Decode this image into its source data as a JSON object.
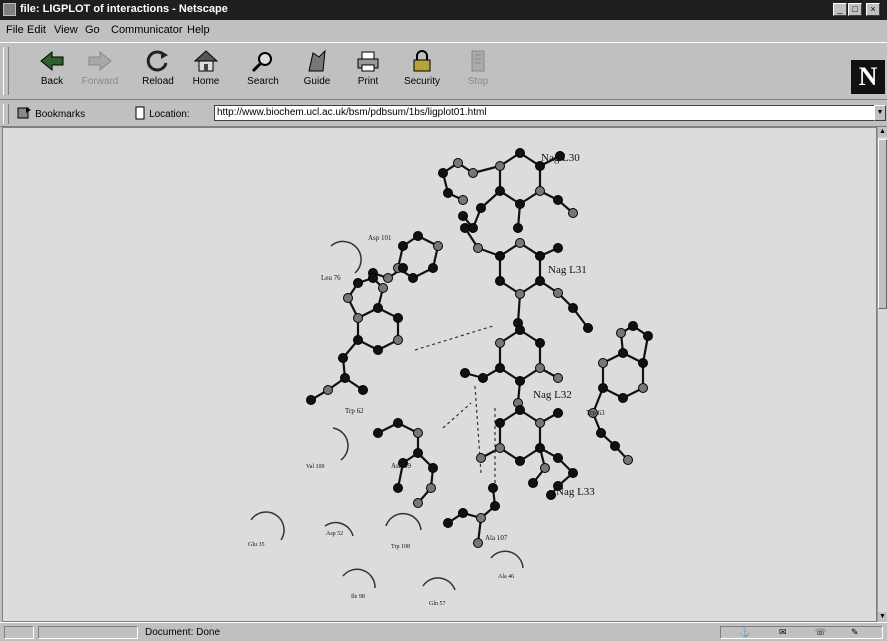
{
  "window": {
    "title": "file: LIGPLOT of interactions - Netscape"
  },
  "menu": {
    "items": [
      "File",
      "Edit",
      "View",
      "Go",
      "Communicator",
      "Help"
    ]
  },
  "toolbar": {
    "buttons": [
      {
        "label": "Back",
        "icon": "back-arrow-icon",
        "enabled": true
      },
      {
        "label": "Forward",
        "icon": "forward-arrow-icon",
        "enabled": false
      },
      {
        "label": "Reload",
        "icon": "reload-icon",
        "enabled": true
      },
      {
        "label": "Home",
        "icon": "home-icon",
        "enabled": true
      },
      {
        "label": "Search",
        "icon": "search-icon",
        "enabled": true
      },
      {
        "label": "Guide",
        "icon": "guide-icon",
        "enabled": true
      },
      {
        "label": "Print",
        "icon": "print-icon",
        "enabled": true
      },
      {
        "label": "Security",
        "icon": "security-icon",
        "enabled": true
      },
      {
        "label": "Stop",
        "icon": "stop-icon",
        "enabled": false
      }
    ]
  },
  "brand": {
    "logo_letter": "N"
  },
  "location": {
    "bookmarks_label": "Bookmarks",
    "location_label": "Location:",
    "url": "http://www.biochem.ucl.ac.uk/bsm/pdbsum/1bs/ligplot01.html"
  },
  "ligplot": {
    "residue_labels": [
      "Nag L30",
      "Nag L31",
      "Nag L32",
      "Nag L33",
      "Asp 101",
      "Leu 76",
      "Trp 62",
      "Trp 63",
      "Asn 59",
      "Ala 107",
      "Val 109",
      "Asp 52",
      "Glu 35",
      "Trp 108",
      "Ile 98",
      "Gln 57",
      "Ala 46"
    ]
  },
  "status": {
    "text": "Document: Done"
  }
}
